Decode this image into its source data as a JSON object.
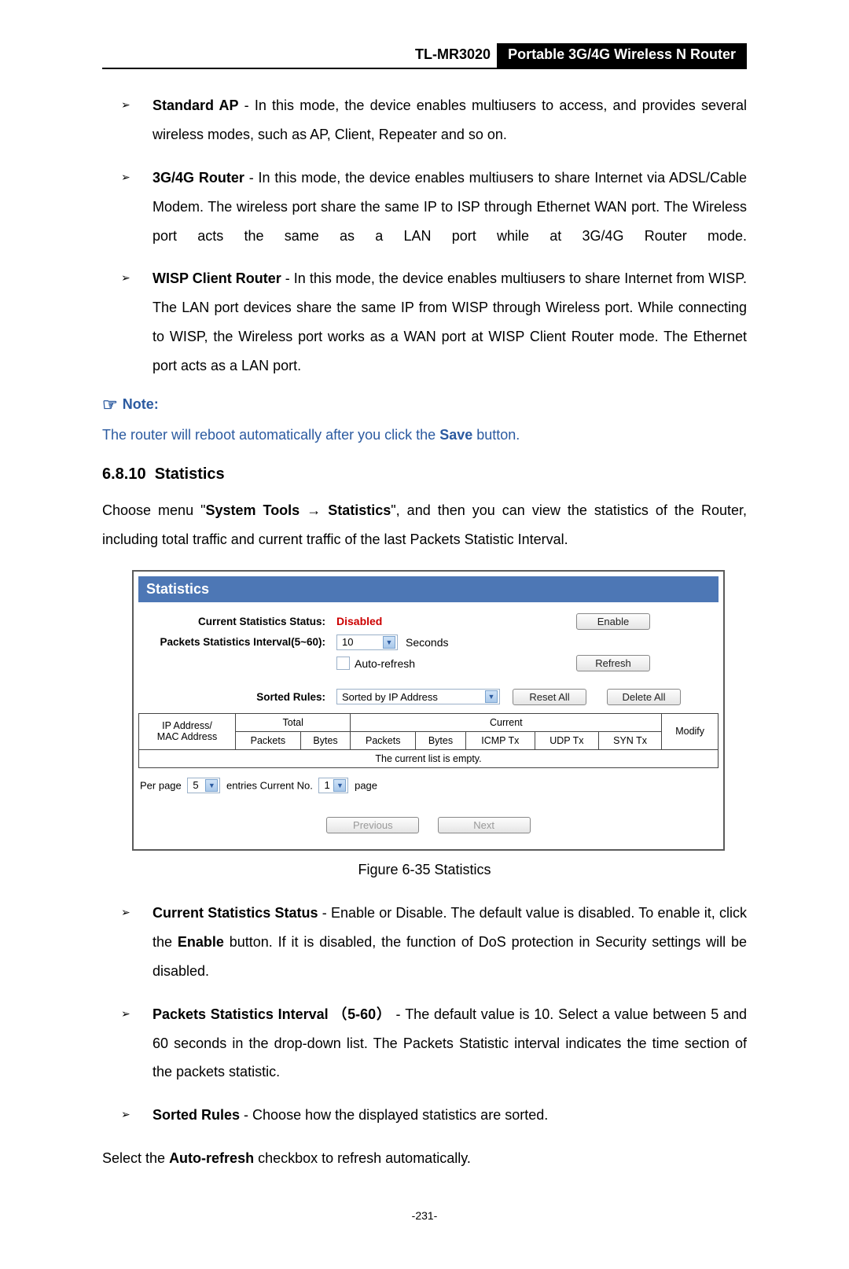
{
  "header": {
    "model": "TL-MR3020",
    "title": "Portable 3G/4G Wireless N Router"
  },
  "modes": [
    {
      "name": "Standard AP",
      "sep": " - ",
      "desc": "In this mode, the device enables multiusers to access, and provides several wireless modes, such as AP, Client, Repeater and so on."
    },
    {
      "name": "3G/4G Router",
      "sep": " - ",
      "desc": "In this mode, the device enables multiusers to share Internet via ADSL/Cable Modem. The wireless port share the same IP to ISP through Ethernet WAN port. The Wireless port acts the same as a LAN port while at 3G/4G Router mode."
    },
    {
      "name": "WISP Client Router",
      "sep": " - ",
      "desc": "In this mode, the device enables multiusers to share Internet from WISP. The LAN port devices share the same IP from WISP through Wireless port. While connecting to WISP, the Wireless port works as a WAN port at WISP Client Router mode. The Ethernet port acts as a LAN port."
    }
  ],
  "note": {
    "heading": "Note:",
    "body_pre": "The router will reboot automatically after you click the ",
    "body_bold": "Save",
    "body_post": " button."
  },
  "section": {
    "number": "6.8.10",
    "title": "Statistics",
    "intro_pre": "Choose menu \"",
    "intro_b1": "System Tools",
    "intro_arrow": " → ",
    "intro_b2": "Statistics",
    "intro_post": "\", and then you can view the statistics of the Router, including total traffic and current traffic of the last Packets Statistic Interval."
  },
  "shot": {
    "panel_title": "Statistics",
    "row1_label": "Current Statistics Status:",
    "row1_value": "Disabled",
    "row1_button": "Enable",
    "row2_label": "Packets Statistics Interval(5~60):",
    "row2_select": "10",
    "row2_unit": "Seconds",
    "row3_checkbox_label": "Auto-refresh",
    "row3_button": "Refresh",
    "sorted_label": "Sorted Rules:",
    "sorted_select": "Sorted by IP Address",
    "sorted_btn1": "Reset All",
    "sorted_btn2": "Delete All",
    "table_headers": {
      "col0": "IP Address/\nMAC Address",
      "grp_total": "Total",
      "grp_current": "Current",
      "modify": "Modify",
      "t_packets": "Packets",
      "t_bytes": "Bytes",
      "c_packets": "Packets",
      "c_bytes": "Bytes",
      "c_icmp": "ICMP Tx",
      "c_udp": "UDP Tx",
      "c_syn": "SYN Tx"
    },
    "empty_msg": "The current list is empty.",
    "pager_pre": "Per page",
    "pager_sel": "5",
    "pager_mid": "entries  Current No.",
    "pager_sel2": "1",
    "pager_post": "page",
    "prev": "Previous",
    "next": "Next"
  },
  "figcap": "Figure 6-35    Statistics",
  "bullets2": [
    {
      "name": "Current Statistics Status",
      "sep": " - ",
      "mid1": "Enable or Disable. The default value is disabled. To enable it, click the ",
      "bold_in": "Enable",
      "mid2": " button. If it is disabled, the function of DoS protection in Security settings will be disabled."
    },
    {
      "name": "Packets Statistics Interval",
      "sep": " ",
      "bold2": "（5-60）",
      "sep2": " - ",
      "desc": "The default value is 10. Select a value between 5 and 60 seconds in the drop-down list. The Packets Statistic interval indicates the time section of the packets statistic."
    },
    {
      "name": "Sorted Rules",
      "sep": " - ",
      "desc": "Choose how the displayed statistics are sorted."
    }
  ],
  "tail_para_pre": "Select the ",
  "tail_para_bold": "Auto-refresh",
  "tail_para_post": " checkbox to refresh automatically.",
  "page_number": "-231-"
}
